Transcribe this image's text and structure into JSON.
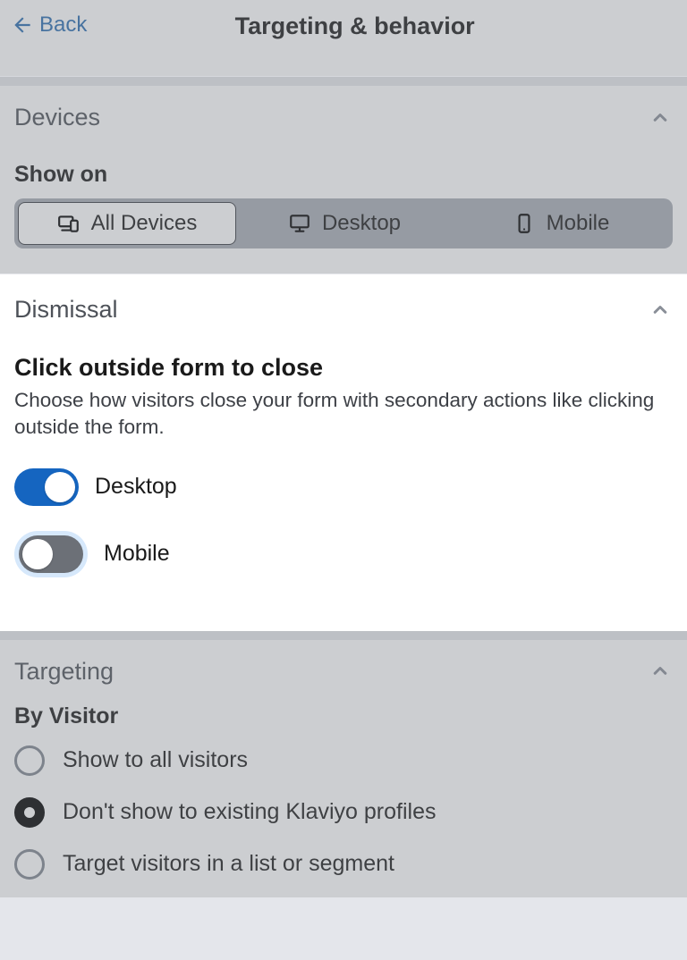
{
  "header": {
    "back_label": "Back",
    "title": "Targeting & behavior"
  },
  "devices": {
    "section_title": "Devices",
    "show_on_label": "Show on",
    "options": {
      "all": "All Devices",
      "desktop": "Desktop",
      "mobile": "Mobile"
    }
  },
  "dismissal": {
    "section_title": "Dismissal",
    "heading": "Click outside form to close",
    "helper": "Choose how visitors close your form with secondary actions like clicking outside the form.",
    "desktop_label": "Desktop",
    "mobile_label": "Mobile",
    "desktop_on": true,
    "mobile_on": false
  },
  "targeting": {
    "section_title": "Targeting",
    "by_visitor_label": "By Visitor",
    "options": {
      "all": "Show to all visitors",
      "exclude_existing": "Don't show to existing Klaviyo profiles",
      "list_segment": "Target visitors in a list or segment"
    },
    "selected": "exclude_existing"
  }
}
